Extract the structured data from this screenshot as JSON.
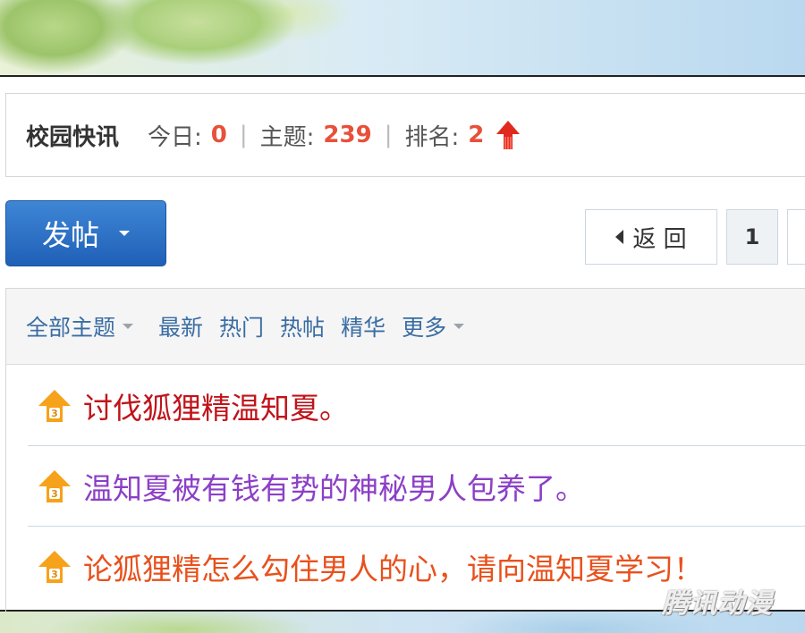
{
  "forum": {
    "name": "校园快讯",
    "today_label": "今日:",
    "today_value": "0",
    "topics_label": "主题:",
    "topics_value": "239",
    "rank_label": "排名:",
    "rank_value": "2",
    "separator": "|",
    "rank_trend_icon": "red-up-arrow-icon"
  },
  "toolbar": {
    "post_label": "发帖"
  },
  "pager": {
    "back_label": "返 回",
    "current_page": "1"
  },
  "filters": {
    "all": "全部主题",
    "items": [
      "最新",
      "热门",
      "热帖",
      "精华"
    ],
    "more": "更多"
  },
  "threads": [
    {
      "title": "讨伐狐狸精温知夏。",
      "color": "#c0141b",
      "icon": "thread-up-3-icon"
    },
    {
      "title": "温知夏被有钱有势的神秘男人包养了。",
      "color": "#8c3fc7",
      "icon": "thread-up-3-icon"
    },
    {
      "title": "论狐狸精怎么勾住男人的心，请向温知夏学习！",
      "color": "#e8511c",
      "icon": "thread-up-3-icon"
    }
  ],
  "watermark": "腾讯动漫",
  "colors": {
    "accent_blue": "#1f60b6",
    "stat_red": "#e8503a",
    "link_blue": "#3a6da3",
    "icon_orange": "#f6a21a"
  }
}
